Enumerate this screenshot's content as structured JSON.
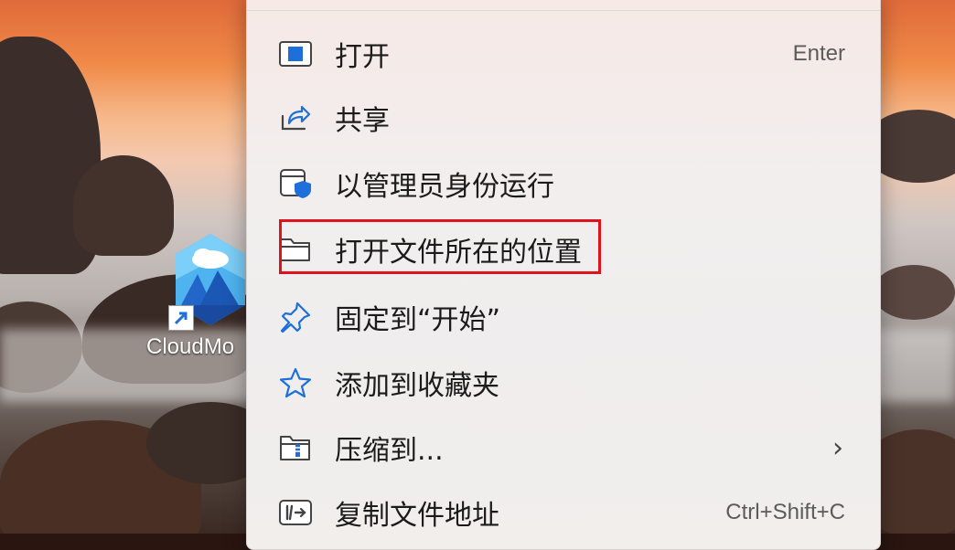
{
  "desktop": {
    "shortcut_label": "CloudMo"
  },
  "context_menu": {
    "items": [
      {
        "label": "打开",
        "shortcut": "Enter",
        "icon": "open-window-icon"
      },
      {
        "label": "共享",
        "shortcut": "",
        "icon": "share-icon"
      },
      {
        "label": "以管理员身份运行",
        "shortcut": "",
        "icon": "admin-shield-icon"
      },
      {
        "label": "打开文件所在的位置",
        "shortcut": "",
        "icon": "folder-icon",
        "highlighted": true
      },
      {
        "label": "固定到“开始”",
        "shortcut": "",
        "icon": "pin-icon"
      },
      {
        "label": "添加到收藏夹",
        "shortcut": "",
        "icon": "star-icon"
      },
      {
        "label": "压缩到...",
        "shortcut": "",
        "icon": "zip-folder-icon",
        "has_submenu": true
      },
      {
        "label": "复制文件地址",
        "shortcut": "Ctrl+Shift+C",
        "icon": "copy-path-icon"
      }
    ],
    "highlight_color": "#e0121c",
    "accent_color": "#1e6fd9"
  }
}
